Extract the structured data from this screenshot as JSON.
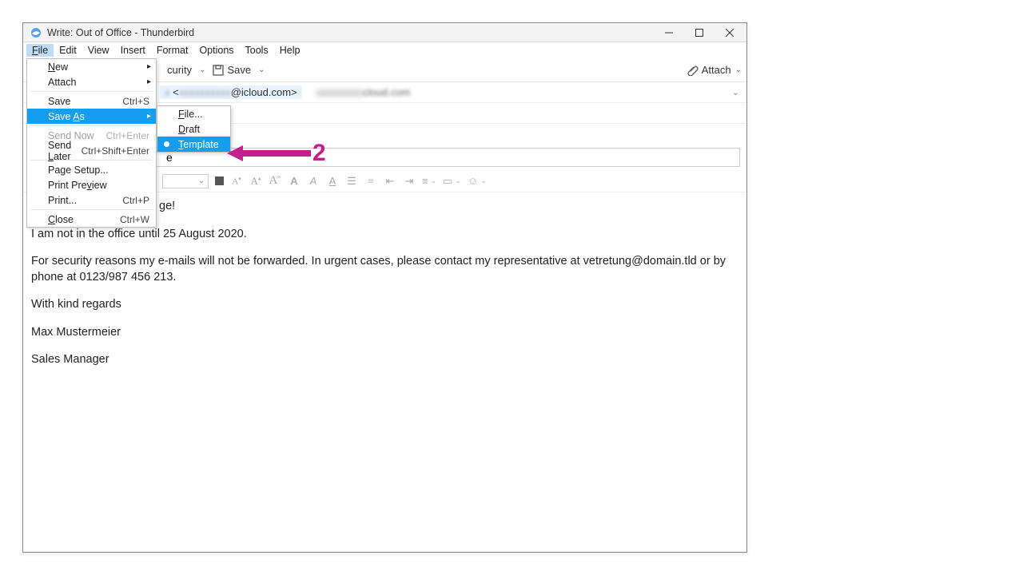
{
  "window": {
    "title": "Write: Out of Office - Thunderbird"
  },
  "menubar": {
    "file": "File",
    "edit": "Edit",
    "view": "View",
    "insert": "Insert",
    "format": "Format",
    "options": "Options",
    "tools": "Tools",
    "help": "Help"
  },
  "filemenu": {
    "new": "New",
    "attach": "Attach",
    "save": "Save",
    "save_accel": "Ctrl+S",
    "save_as": "Save As",
    "send_now": "Send Now",
    "send_now_accel": "Ctrl+Enter",
    "send_later": "Send Later",
    "send_later_accel": "Ctrl+Shift+Enter",
    "page_setup": "Page Setup...",
    "print_preview": "Print Preview",
    "print": "Print...",
    "print_accel": "Ctrl+P",
    "close": "Close",
    "close_accel": "Ctrl+W"
  },
  "saveas_sub": {
    "file": "File...",
    "draft": "Draft",
    "template": "Template"
  },
  "annotation": {
    "num": "2"
  },
  "toolbar": {
    "security": "curity",
    "save_label": "Save",
    "attach_label": "Attach"
  },
  "header": {
    "from_tail": "@icloud.com>",
    "extra_blur": "cloud.com"
  },
  "subject_value": "e",
  "body": {
    "p0_fragment": "ge!",
    "p1": "I am not in the office until 25 August 2020.",
    "p2": "For security reasons my e-mails will not be forwarded. In urgent cases, please contact my representative at vetretung@domain.tld or by phone at 0123/987 456 213.",
    "p3": "With kind regards",
    "p4": "Max Mustermeier",
    "p5": "Sales Manager"
  }
}
